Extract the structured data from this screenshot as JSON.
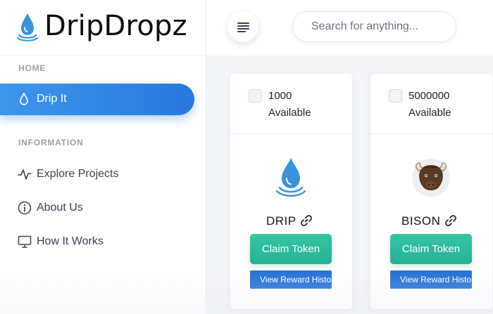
{
  "brand": {
    "name": "DripDropz",
    "icon": "water-drop-icon"
  },
  "topbar": {
    "menu_icon": "hamburger-menu-icon",
    "search_placeholder": "Search for anything..."
  },
  "sidebar": {
    "sections": [
      {
        "label": "HOME"
      },
      {
        "label": "INFORMATION"
      }
    ],
    "items": [
      {
        "label": "Drip It",
        "icon": "drop-icon",
        "active": true
      },
      {
        "label": "Explore Projects",
        "icon": "activity-icon"
      },
      {
        "label": "About Us",
        "icon": "info-icon"
      },
      {
        "label": "How It Works",
        "icon": "monitor-icon"
      }
    ]
  },
  "tokens": [
    {
      "amount": "1000",
      "available_label": "Available",
      "name": "DRIP",
      "logo": "water-drop-logo",
      "claim_label": "Claim Token",
      "history_label": "View Reward History"
    },
    {
      "amount": "5000000",
      "available_label": "Available",
      "name": "BISON",
      "logo": "bison-logo",
      "claim_label": "Claim Token",
      "history_label": "View Reward History"
    }
  ],
  "colors": {
    "accent_blue": "#2a77de",
    "claim_green": "#27b294",
    "history_blue": "#2773d8",
    "brand_drop": "#3b93d8"
  }
}
